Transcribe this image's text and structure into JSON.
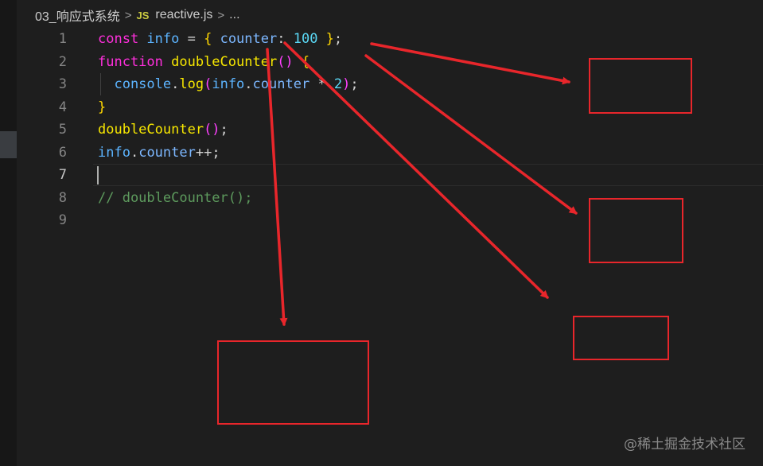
{
  "breadcrumb": {
    "folder": "03_响应式系统",
    "separator": ">",
    "file_icon": "JS",
    "file": "reactive.js",
    "ellipsis": "..."
  },
  "editor": {
    "line_numbers": [
      "1",
      "2",
      "3",
      "4",
      "5",
      "6",
      "7",
      "8",
      "9"
    ],
    "active_line": "7",
    "lines": [
      [
        {
          "t": "const ",
          "c": "kw"
        },
        {
          "t": "info",
          "c": "var"
        },
        {
          "t": " = ",
          "c": "pun"
        },
        {
          "t": "{ ",
          "c": "br"
        },
        {
          "t": "counter",
          "c": "prop"
        },
        {
          "t": ": ",
          "c": "pun"
        },
        {
          "t": "100",
          "c": "num"
        },
        {
          "t": " }",
          "c": "br"
        },
        {
          "t": ";",
          "c": "pun"
        }
      ],
      [
        {
          "t": "function ",
          "c": "kw"
        },
        {
          "t": "doubleCounter",
          "c": "fn"
        },
        {
          "t": "() ",
          "c": "br2"
        },
        {
          "t": "{",
          "c": "br"
        }
      ],
      [
        {
          "t": "  console",
          "c": "var"
        },
        {
          "t": ".",
          "c": "pun"
        },
        {
          "t": "log",
          "c": "fn"
        },
        {
          "t": "(",
          "c": "br2"
        },
        {
          "t": "info",
          "c": "var"
        },
        {
          "t": ".",
          "c": "pun"
        },
        {
          "t": "counter",
          "c": "prop"
        },
        {
          "t": " * ",
          "c": "pun"
        },
        {
          "t": "2",
          "c": "num"
        },
        {
          "t": ")",
          "c": "br2"
        },
        {
          "t": ";",
          "c": "pun"
        }
      ],
      [
        {
          "t": "}",
          "c": "br"
        }
      ],
      [
        {
          "t": "doubleCounter",
          "c": "fn"
        },
        {
          "t": "()",
          "c": "br2"
        },
        {
          "t": ";",
          "c": "pun"
        }
      ],
      [
        {
          "t": "info",
          "c": "var"
        },
        {
          "t": ".",
          "c": "pun"
        },
        {
          "t": "counter",
          "c": "prop"
        },
        {
          "t": "++",
          "c": "pun"
        },
        {
          "t": ";",
          "c": "pun"
        }
      ],
      [],
      [
        {
          "t": "// doubleCounter();",
          "c": "cmt"
        }
      ],
      []
    ]
  },
  "annotations": {
    "arrow_color": "#e8262b",
    "box_color": "#e8262b"
  },
  "watermark": "@稀土掘金技术社区"
}
